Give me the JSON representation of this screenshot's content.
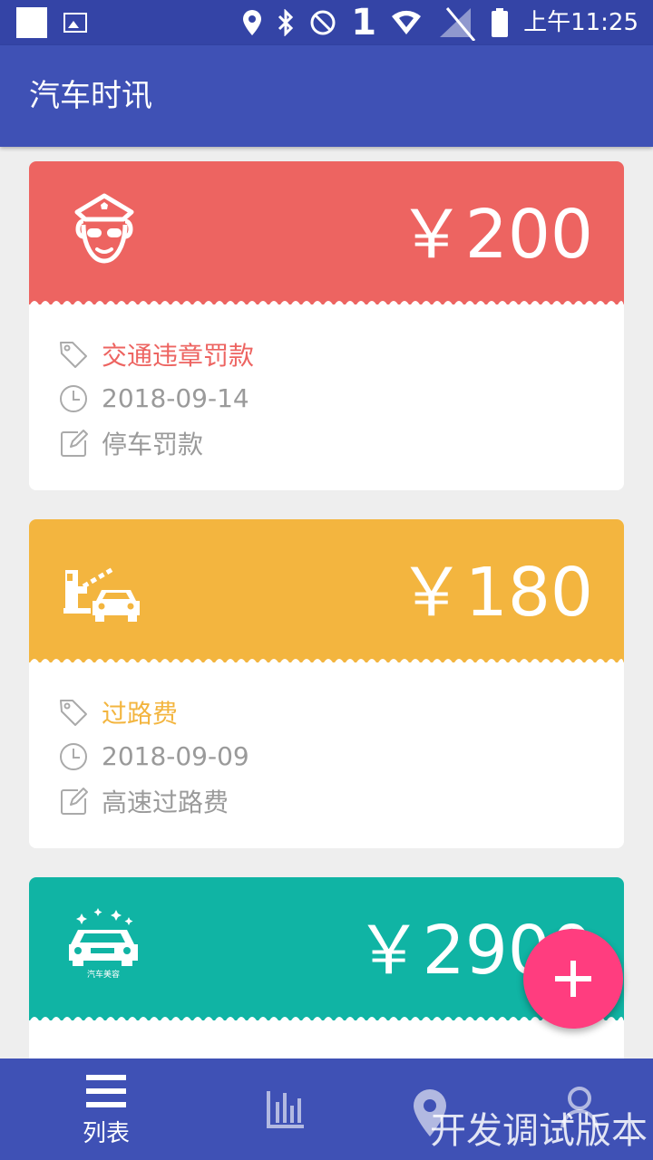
{
  "status_bar": {
    "network_digit": "1",
    "time": "上午11:25"
  },
  "app_bar": {
    "title": "汽车时讯"
  },
  "colors": {
    "primary": "#3f51b5",
    "status_bar": "#3444a6",
    "fine": "#ed6461",
    "toll": "#f3b53f",
    "beauty": "#10b4a4",
    "fab": "#ff3d7f"
  },
  "records": [
    {
      "amount": "￥200",
      "category": "交通违章罚款",
      "date": "2018-09-14",
      "note": "停车罚款",
      "icon": "police-officer-icon"
    },
    {
      "amount": "￥180",
      "category": "过路费",
      "date": "2018-09-09",
      "note": "高速过路费",
      "icon": "toll-gate-car-icon"
    },
    {
      "amount": "￥2900",
      "icon": "car-beauty-icon",
      "icon_caption": "汽车美容"
    }
  ],
  "fab": {
    "icon": "plus-icon"
  },
  "bottom_nav": {
    "items": [
      {
        "label": "列表",
        "icon": "list-icon"
      },
      {
        "icon": "bar-chart-icon"
      },
      {
        "icon": "map-pin-icon"
      },
      {
        "icon": "person-icon"
      }
    ]
  },
  "watermark": "开发调试版本"
}
